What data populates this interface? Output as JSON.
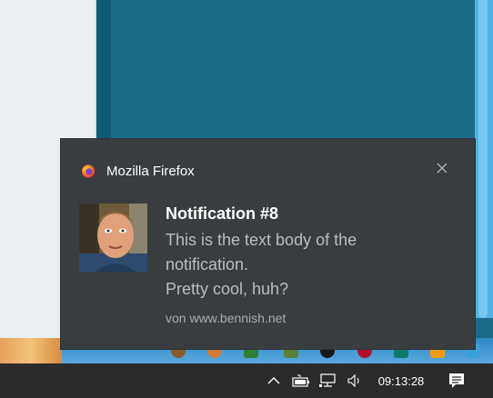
{
  "notification": {
    "app_name": "Mozilla Firefox",
    "app_icon": "firefox-icon",
    "close_icon": "close-icon",
    "title": "Notification #8",
    "body_lines": [
      "This is the text body of the",
      "notification.",
      "Pretty cool, huh?"
    ],
    "attribution": "von www.bennish.net",
    "image": "avatar-photo"
  },
  "taskbar": {
    "clock": "09:13:28",
    "tray_icons": [
      "chevron-up-icon",
      "battery-icon",
      "network-icon",
      "volume-icon",
      "action-center-icon"
    ]
  },
  "colors": {
    "toast_bg": "#3a3d40",
    "taskbar_bg": "#2b2b2b",
    "desktop_bg": "#1b6a86"
  }
}
